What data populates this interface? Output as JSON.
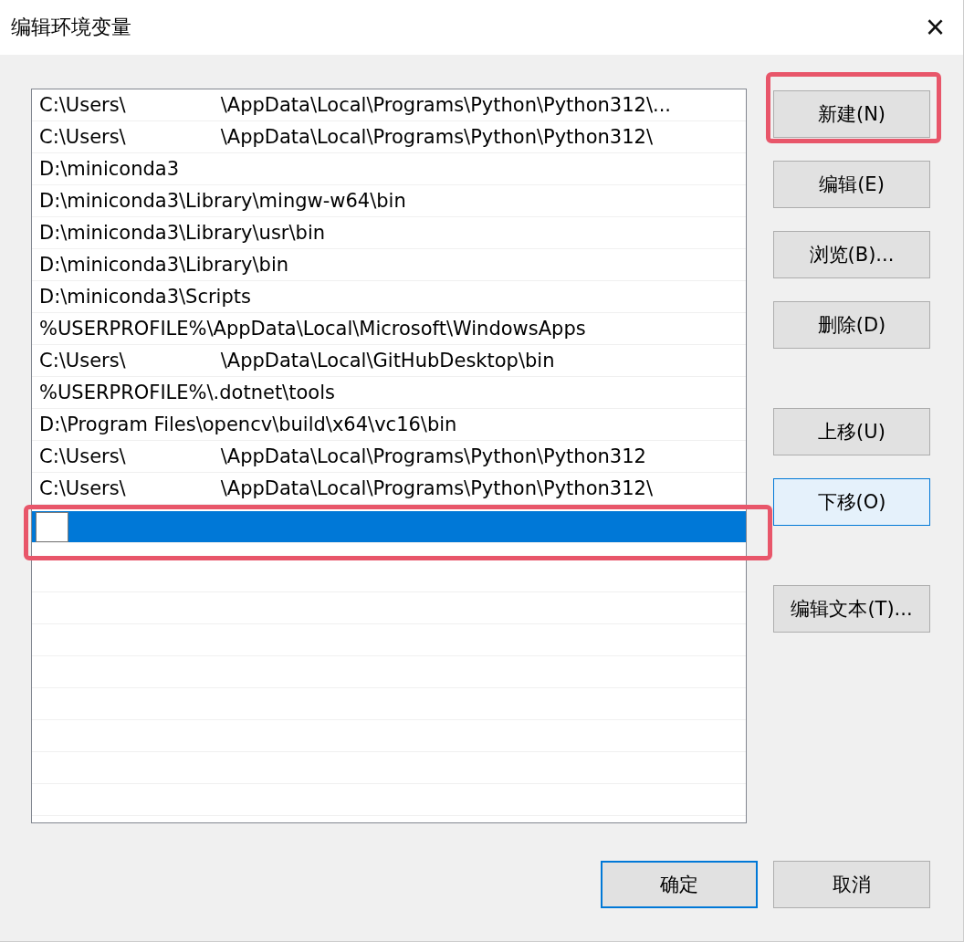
{
  "window": {
    "title": "编辑环境变量",
    "close": "×"
  },
  "paths": [
    {
      "kind": "text",
      "before": "C:\\Users\\",
      "after": "\\AppData\\Local\\Programs\\Python\\Python312\\...",
      "selected": false
    },
    {
      "kind": "text",
      "before": "C:\\Users\\",
      "after": "\\AppData\\Local\\Programs\\Python\\Python312\\",
      "selected": false
    },
    {
      "kind": "text",
      "before": "D:\\miniconda3",
      "selected": false
    },
    {
      "kind": "text",
      "before": "D:\\miniconda3\\Library\\mingw-w64\\bin",
      "selected": false
    },
    {
      "kind": "text",
      "before": "D:\\miniconda3\\Library\\usr\\bin",
      "selected": false
    },
    {
      "kind": "text",
      "before": "D:\\miniconda3\\Library\\bin",
      "selected": false
    },
    {
      "kind": "text",
      "before": "D:\\miniconda3\\Scripts",
      "selected": false
    },
    {
      "kind": "text",
      "before": "%USERPROFILE%\\AppData\\Local\\Microsoft\\WindowsApps",
      "selected": false
    },
    {
      "kind": "text",
      "before": "C:\\Users\\",
      "after": "\\AppData\\Local\\GitHubDesktop\\bin",
      "selected": false
    },
    {
      "kind": "text",
      "before": "%USERPROFILE%\\.dotnet\\tools",
      "selected": false
    },
    {
      "kind": "text",
      "before": "D:\\Program Files\\opencv\\build\\x64\\vc16\\bin",
      "selected": false
    },
    {
      "kind": "text",
      "before": "C:\\Users\\",
      "after": "\\AppData\\Local\\Programs\\Python\\Python312",
      "selected": false
    },
    {
      "kind": "text",
      "before": "C:\\Users\\",
      "after": "\\AppData\\Local\\Programs\\Python\\Python312\\",
      "selected": false
    },
    {
      "kind": "editing",
      "selected": true,
      "highlighted": true
    }
  ],
  "button_groups": [
    [
      {
        "label": "新建(N)",
        "focused": false,
        "highlighted": true
      },
      {
        "label": "编辑(E)",
        "focused": false,
        "highlighted": false
      },
      {
        "label": "浏览(B)...",
        "focused": false,
        "highlighted": false
      },
      {
        "label": "删除(D)",
        "focused": false,
        "highlighted": false
      }
    ],
    [
      {
        "label": "上移(U)",
        "focused": false,
        "highlighted": false
      },
      {
        "label": "下移(O)",
        "focused": true,
        "highlighted": false
      }
    ],
    [
      {
        "label": "编辑文本(T)...",
        "focused": false,
        "highlighted": false
      }
    ]
  ],
  "footer_buttons": [
    {
      "label": "确定",
      "default": true
    },
    {
      "label": "取消",
      "default": false
    }
  ]
}
